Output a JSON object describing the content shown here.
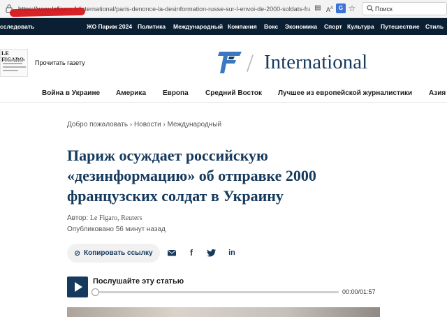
{
  "browser": {
    "url_host": "https://www.lefigaro.fr",
    "url_path": "/international/paris-denonce-la-desinformation-russe-sur-l-envoi-de-2000-soldats-franca",
    "search_placeholder": "Поиск",
    "icons": [
      "lock-icon",
      "reader-icon",
      "text-size-icon",
      "translate-icon",
      "star-icon",
      "refresh-icon",
      "search-icon"
    ]
  },
  "top_nav": {
    "items": [
      "сследовать",
      "ЖО Париж 2024",
      "Политика",
      "Международный",
      "Компания",
      "Вокс",
      "Экономика",
      "Спорт",
      "Культура",
      "Путешествие",
      "Стиль"
    ],
    "background": "#0b1f33"
  },
  "masthead": {
    "read_paper": "Прочитать газету",
    "paper_thumb_title": "LE FIGARO",
    "logo_slash": "/",
    "logo_word": "International",
    "brand_color": "#163a5d"
  },
  "section_nav": {
    "items": [
      "Война в Украине",
      "Америка",
      "Европа",
      "Средний Восток",
      "Лучшее из европейской журналистики",
      "Азия"
    ]
  },
  "article": {
    "breadcrumb": [
      "Добро пожаловать",
      "Новости",
      "Международный"
    ],
    "breadcrumb_separator": "›",
    "headline": "Париж осуждает российскую «дезинформацию» об отправке 2000 французских солдат в Украину",
    "author_label": "Автор:",
    "author_value": "Le Figaro, Reuters",
    "published_label": "Опубликовано",
    "published_value": "56 минут назад"
  },
  "share": {
    "copy_link_label": "Копировать ссылку",
    "icons": [
      "email-icon",
      "facebook-icon",
      "twitter-icon",
      "linkedin-icon"
    ]
  },
  "audio": {
    "listen_label": "Послушайте эту статью",
    "time": "00:00/01:57",
    "progress": 0
  }
}
